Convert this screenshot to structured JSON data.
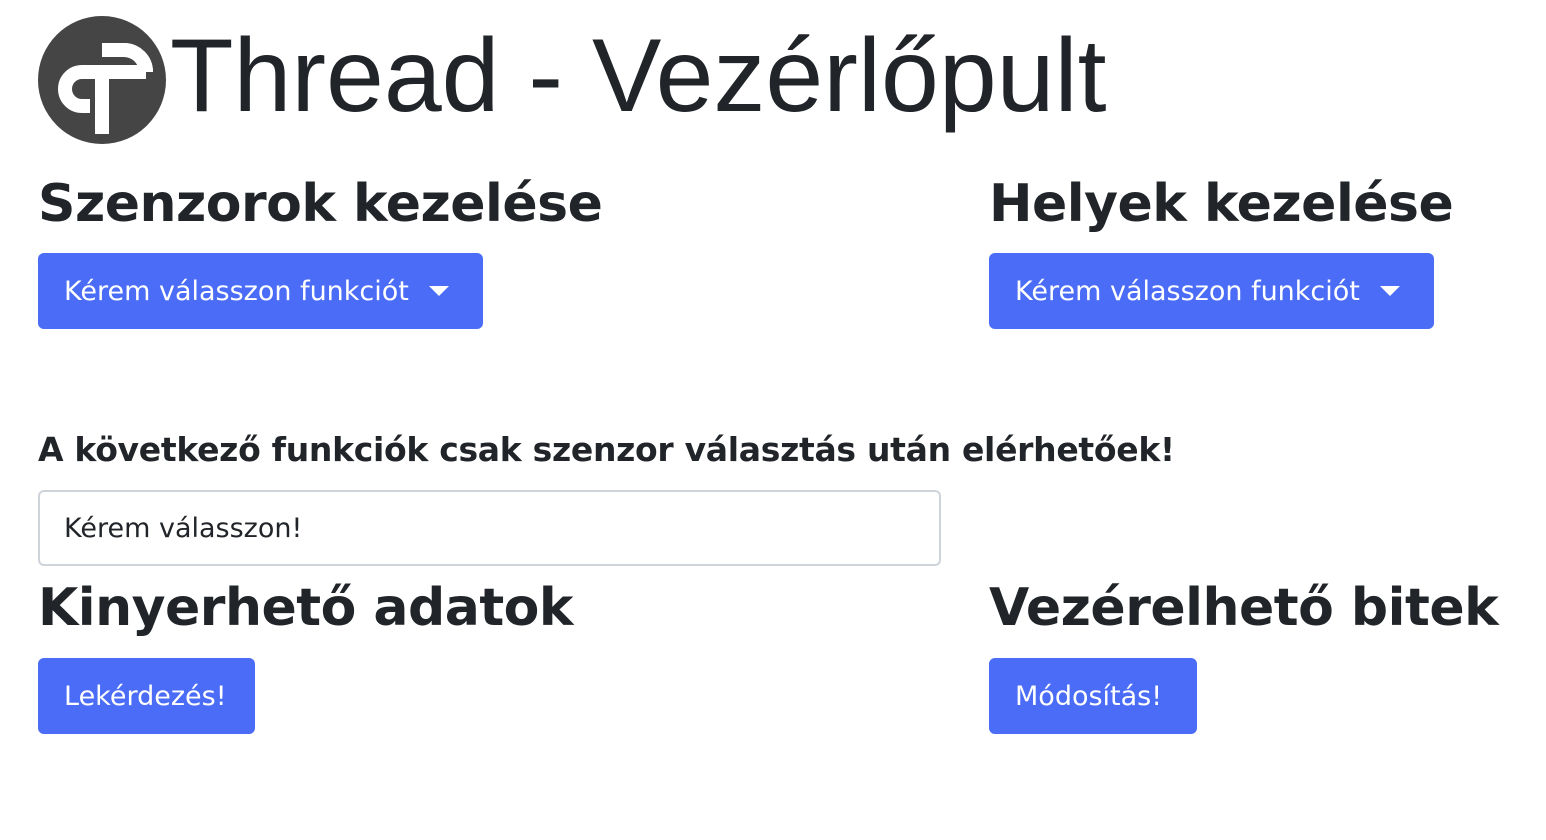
{
  "header": {
    "title": "Thread - Vezérlőpult",
    "logo_icon": "thread-logo-icon"
  },
  "sensors": {
    "title": "Szenzorok kezelése",
    "dropdown_label": "Kérem válasszon funkciót"
  },
  "places": {
    "title": "Helyek kezelése",
    "dropdown_label": "Kérem válasszon funkciót"
  },
  "notice": "A következő funkciók csak szenzor választás után elérhetőek!",
  "sensor_select": {
    "value": "Kérem válasszon!"
  },
  "data_section": {
    "title": "Kinyerhető adatok",
    "button_label": "Lekérdezés!"
  },
  "bits_section": {
    "title": "Vezérelhető bitek",
    "button_label": "Módosítás!"
  },
  "colors": {
    "accent": "#4a6cf7",
    "text": "#212529",
    "logo": "#454545",
    "border": "#ced4da"
  }
}
